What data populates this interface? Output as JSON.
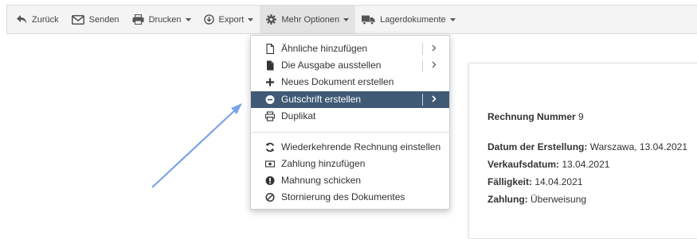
{
  "toolbar": {
    "back": "Zurück",
    "send": "Senden",
    "print": "Drucken",
    "export": "Export",
    "more": "Mehr Optionen",
    "warehouse": "Lagerdokumente"
  },
  "menu": {
    "items": [
      {
        "label": "Ähnliche hinzufügen"
      },
      {
        "label": "Die Ausgabe ausstellen"
      },
      {
        "label": "Neues Dokument erstellen"
      },
      {
        "label": "Gutschrift erstellen"
      },
      {
        "label": "Duplikat"
      },
      {
        "label": "Wiederkehrende Rechnung einstellen"
      },
      {
        "label": "Zahlung hinzufügen"
      },
      {
        "label": "Mahnung schicken"
      },
      {
        "label": "Stornierung des Dokumentes"
      }
    ]
  },
  "invoice": {
    "number_label": "Rechnung Nummer",
    "number_value": "9",
    "created_label": "Datum der Erstellung:",
    "created_value": "Warszawa, 13.04.2021",
    "sale_label": "Verkaufsdatum:",
    "sale_value": "13.04.2021",
    "due_label": "Fälligkeit:",
    "due_value": "14.04.2021",
    "payment_label": "Zahlung:",
    "payment_value": "Überweisung"
  },
  "colors": {
    "highlight": "#3f5a75",
    "arrow": "#7ba3e6"
  }
}
